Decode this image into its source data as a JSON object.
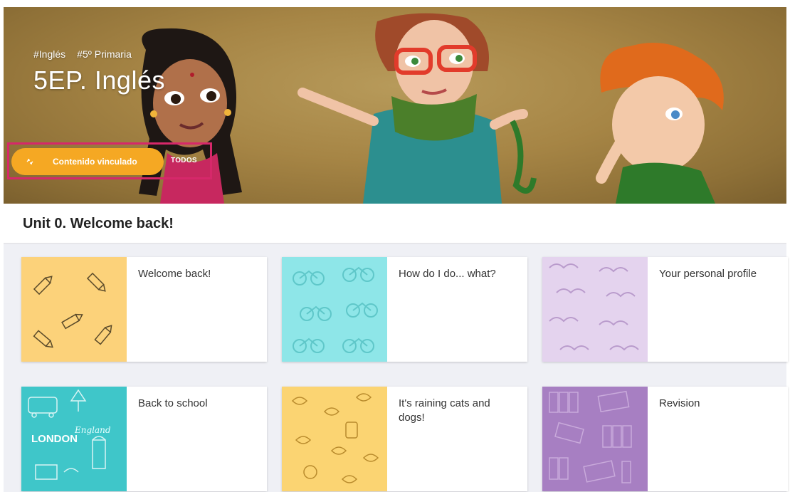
{
  "header": {
    "tags": [
      "#Inglés",
      "#5º Primaria"
    ],
    "title": "5EP. Inglés",
    "linked_button_label": "Contenido vinculado",
    "filter_label": "TODOS"
  },
  "unit": {
    "title": "Unit 0. Welcome back!"
  },
  "cards": [
    {
      "title": "Welcome back!",
      "thumb_color": "#fcd27a",
      "pattern": "pencils"
    },
    {
      "title": "How do I do... what?",
      "thumb_color": "#8ee6e8",
      "pattern": "bicycles"
    },
    {
      "title": "Your personal profile",
      "thumb_color": "#e4d3ee",
      "pattern": "moustaches"
    },
    {
      "title": "Back to school",
      "thumb_color": "#3fc6c9",
      "pattern": "london"
    },
    {
      "title": "It's raining cats and dogs!",
      "thumb_color": "#fbd472",
      "pattern": "leaves"
    },
    {
      "title": "Revision",
      "thumb_color": "#a77fc2",
      "pattern": "books"
    }
  ],
  "colors": {
    "accent": "#f5a823",
    "highlight": "#d6286a",
    "background": "#eff0f5"
  }
}
